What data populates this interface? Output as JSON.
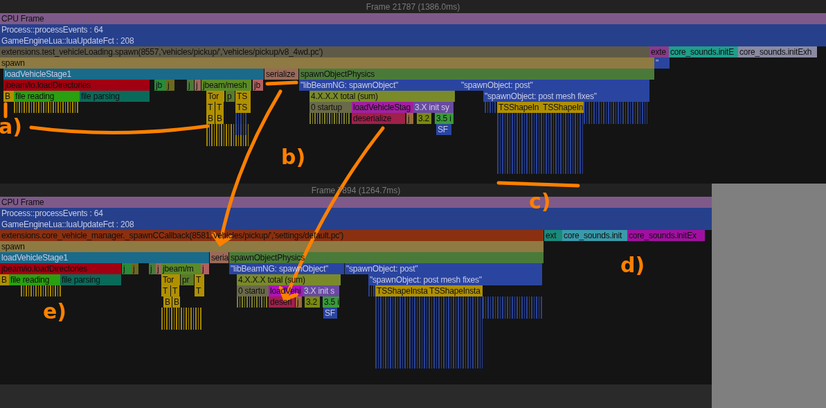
{
  "frames": [
    {
      "title": "Frame 21787 (1386.0ms)",
      "levels": [
        {
          "blocks": [
            {
              "label": "CPU Frame",
              "color": "#7e5a8a"
            }
          ]
        },
        {
          "blocks": [
            {
              "label": "Process::processEvents : 64",
              "color": "#26408c"
            }
          ]
        },
        {
          "blocks": [
            {
              "label": "GameEngineLua::luaUpdateFct : 208",
              "color": "#26408c"
            }
          ]
        },
        {
          "blocks": [
            {
              "label": "extensions.test_vehicleLoading.spawn(8557,'vehicles/pickup/','vehicles/pickup/v8_4wd.pc')",
              "color": "#5f5a48"
            },
            {
              "label": "exte",
              "color": "#8a3a8a"
            },
            {
              "label": "core_sounds.initE",
              "color": "#1f9e8a"
            },
            {
              "label": "core_sounds.initExh",
              "color": "#8a8aa2"
            }
          ]
        },
        {
          "blocks": [
            {
              "label": "spawn",
              "color": "#8e7a42"
            },
            {
              "label": "\"",
              "color": "#2a45a0"
            }
          ]
        },
        {
          "blocks": [
            {
              "label": "loadVehicleStage1",
              "color": "#1a6a8a"
            },
            {
              "label": "serialize",
              "color": "#9a6a5a"
            },
            {
              "label": "spawnObjectPhysics",
              "color": "#4a7a3a"
            }
          ]
        },
        {
          "blocks": [
            {
              "label": "jbeam/io.loadDirectories",
              "color": "#a00012"
            },
            {
              "label": "jb",
              "color": "#2a8a3a"
            },
            {
              "label": "j",
              "color": "#6a6a20"
            },
            {
              "label": "j",
              "color": "#4a7a3a"
            },
            {
              "label": "j",
              "color": "#9a6a5a"
            },
            {
              "label": "jbeam/mesh",
              "color": "#5a8a2a"
            },
            {
              "label": "jb",
              "color": "#b06060"
            },
            {
              "label": "\"libBeamNG: spawnObject\"",
              "color": "#2a45a0"
            },
            {
              "label": "\"spawnObject: post\"",
              "color": "#2a45a0"
            }
          ]
        },
        {
          "blocks": [
            {
              "label": "B",
              "color": "#b09000"
            },
            {
              "label": "file reading",
              "color": "#2aa010"
            },
            {
              "label": "file parsing",
              "color": "#0a6a5a"
            },
            {
              "label": "Tor",
              "color": "#b09000"
            },
            {
              "label": "p",
              "color": "#5a7a2a"
            },
            {
              "label": "TS",
              "color": "#b09000"
            },
            {
              "label": "4.X.X.X total (sum)",
              "color": "#7a8a2a"
            },
            {
              "label": "\"spawnObject: post mesh fixes\"",
              "color": "#2a45a0"
            }
          ]
        },
        {
          "blocks": [
            {
              "label": "T",
              "color": "#b09000"
            },
            {
              "label": "T",
              "color": "#b09000"
            },
            {
              "label": "TS",
              "color": "#b09000"
            },
            {
              "label": "0 startup",
              "color": "#6a6a4a"
            },
            {
              "label": "loadVehicleStag",
              "color": "#a020a0"
            },
            {
              "label": "3.X init sy",
              "color": "#6a4aa0"
            },
            {
              "label": "TSShapeIn",
              "color": "#b09000"
            },
            {
              "label": "TSShapeIn",
              "color": "#b09000"
            }
          ]
        },
        {
          "blocks": [
            {
              "label": "B",
              "color": "#b09000"
            },
            {
              "label": "B",
              "color": "#b09000"
            },
            {
              "label": "deserialize",
              "color": "#a0204a"
            },
            {
              "label": "j",
              "color": "#9a6a3a"
            },
            {
              "label": "3.2",
              "color": "#7a8a10"
            },
            {
              "label": "3.5 i",
              "color": "#3a9a3a"
            }
          ]
        },
        {
          "blocks": [
            {
              "label": "SF",
              "color": "#2a45a0"
            }
          ]
        }
      ]
    },
    {
      "title": "Frame 7894 (1264.7ms)",
      "levels": [
        {
          "blocks": [
            {
              "label": "CPU Frame",
              "color": "#7e5a8a"
            }
          ]
        },
        {
          "blocks": [
            {
              "label": "Process::processEvents : 64",
              "color": "#26408c"
            }
          ]
        },
        {
          "blocks": [
            {
              "label": "GameEngineLua::luaUpdateFct : 208",
              "color": "#26408c"
            }
          ]
        },
        {
          "blocks": [
            {
              "label": "extensions.core_vehicle_manager._spawnCCallback(8581,'vehicles/pickup/','settings/default.pc')",
              "color": "#8a3010"
            },
            {
              "label": "ext",
              "color": "#1a8a7a"
            },
            {
              "label": "core_sounds.init",
              "color": "#3a9aaa"
            },
            {
              "label": "core_sounds.initEx",
              "color": "#a010a0"
            }
          ]
        },
        {
          "blocks": [
            {
              "label": "spawn",
              "color": "#8e7a42"
            }
          ]
        },
        {
          "blocks": [
            {
              "label": "loadVehicleStage1",
              "color": "#1a6a8a"
            },
            {
              "label": "seria",
              "color": "#9a6a5a"
            },
            {
              "label": "spawnObjectPhysics",
              "color": "#4a7a3a"
            }
          ]
        },
        {
          "blocks": [
            {
              "label": "jbeam/io.loadDirectories",
              "color": "#a00012"
            },
            {
              "label": "j",
              "color": "#2a8a3a"
            },
            {
              "label": "j",
              "color": "#6a6a20"
            },
            {
              "label": "j",
              "color": "#4a7a3a"
            },
            {
              "label": "j",
              "color": "#9a6a5a"
            },
            {
              "label": "jbeam/m",
              "color": "#5a8a2a"
            },
            {
              "label": "j",
              "color": "#b06060"
            },
            {
              "label": "\"libBeamNG: spawnObject\"",
              "color": "#2a45a0"
            },
            {
              "label": "\"spawnObject: post\"",
              "color": "#2a45a0"
            }
          ]
        },
        {
          "blocks": [
            {
              "label": "B",
              "color": "#b09000"
            },
            {
              "label": "file reading",
              "color": "#2aa010"
            },
            {
              "label": "file parsing",
              "color": "#0a6a5a"
            },
            {
              "label": "Tor",
              "color": "#b09000"
            },
            {
              "label": "pr",
              "color": "#5a7a2a"
            },
            {
              "label": "T",
              "color": "#b09000"
            },
            {
              "label": "4.X.X.X total (sum)",
              "color": "#7a8a2a"
            },
            {
              "label": "\"spawnObject: post mesh fixes\"",
              "color": "#2a45a0"
            }
          ]
        },
        {
          "blocks": [
            {
              "label": "T",
              "color": "#b09000"
            },
            {
              "label": "T",
              "color": "#b09000"
            },
            {
              "label": "T",
              "color": "#b09000"
            },
            {
              "label": "0 startu",
              "color": "#6a6a4a"
            },
            {
              "label": "loadVehi",
              "color": "#b010c0"
            },
            {
              "label": "3.X init s",
              "color": "#6a4aa0"
            },
            {
              "label": "TSShapeInsta",
              "color": "#b09000"
            },
            {
              "label": "TSShapeInsta",
              "color": "#b09000"
            }
          ]
        },
        {
          "blocks": [
            {
              "label": "B",
              "color": "#b09000"
            },
            {
              "label": "B",
              "color": "#b09000"
            },
            {
              "label": "deseri",
              "color": "#a0204a"
            },
            {
              "label": "j",
              "color": "#9a6a3a"
            },
            {
              "label": "3.2",
              "color": "#7a8a10"
            },
            {
              "label": "3.5 i",
              "color": "#3a9a3a"
            }
          ]
        },
        {
          "blocks": [
            {
              "label": "SF",
              "color": "#2a45a0"
            }
          ]
        }
      ]
    }
  ],
  "annotations": [
    {
      "label": "a)"
    },
    {
      "label": "b)"
    },
    {
      "label": "c)"
    },
    {
      "label": "d)"
    },
    {
      "label": "e)"
    }
  ]
}
